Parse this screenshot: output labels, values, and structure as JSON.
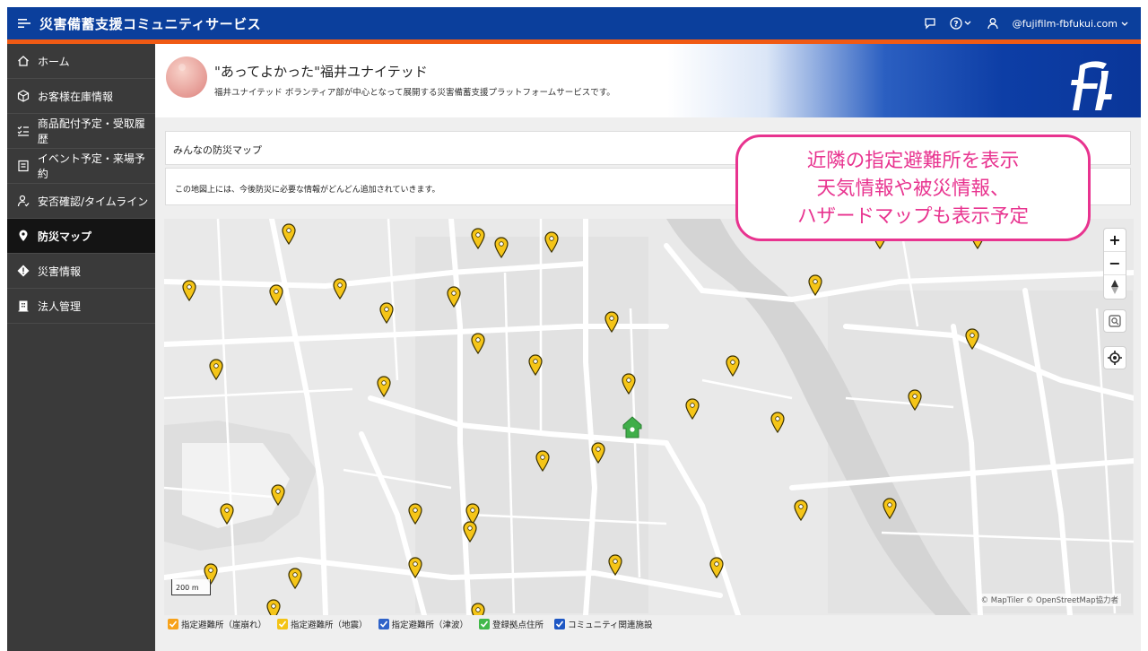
{
  "header": {
    "app_title": "災害備蓄支援コミュニティサービス",
    "user": "@fujifilm-fbfukui.com"
  },
  "sidebar": {
    "items": [
      {
        "label": "ホーム",
        "icon": "home-icon"
      },
      {
        "label": "お客様在庫情報",
        "icon": "box-icon"
      },
      {
        "label": "商品配付予定・受取履歴",
        "icon": "checklist-icon"
      },
      {
        "label": "イベント予定・来場予約",
        "icon": "event-icon"
      },
      {
        "label": "安否確認/タイムライン",
        "icon": "person-icon"
      },
      {
        "label": "防災マップ",
        "icon": "map-pin-icon",
        "active": true
      },
      {
        "label": "災害情報",
        "icon": "warning-icon"
      },
      {
        "label": "法人管理",
        "icon": "building-icon"
      }
    ]
  },
  "banner": {
    "org_name": "\"あってよかった\"福井ユナイテッド",
    "description": "福井ユナイテッド ボランティア部が中心となって展開する災害備蓄支援プラットフォームサービスです。"
  },
  "page": {
    "title": "みんなの防災マップ",
    "description": "この地図上には、今後防災に必要な情報がどんどん追加されていきます。"
  },
  "map": {
    "scale_label": "200 m",
    "attribution": "© MapTiler  © OpenStreetMap協力者",
    "controls": {
      "zoom_in": "+",
      "zoom_out": "−"
    }
  },
  "legend": [
    {
      "label": "指定避難所（崖崩れ）",
      "color": "#f7a21b",
      "checked": true
    },
    {
      "label": "指定避難所（地震）",
      "color": "#f3c316",
      "checked": true
    },
    {
      "label": "指定避難所（津波）",
      "color": "#2f63c9",
      "checked": true
    },
    {
      "label": "登録拠点住所",
      "color": "#42b84a",
      "checked": true
    },
    {
      "label": "コミュニティ関連施設",
      "color": "#1e57c4",
      "checked": true
    }
  ],
  "callout": {
    "line1": "近隣の指定避難所を表示",
    "line2": "天気情報や被災情報、",
    "line3": "ハザードマップも表示予定"
  },
  "colors": {
    "header_bg": "#0b3f9c",
    "accent_strip": "#f05a14",
    "sidebar_bg": "#3a3a3a",
    "pin_yellow": "#f5c518",
    "home_pin": "#3fae49",
    "callout": "#e8338f"
  }
}
